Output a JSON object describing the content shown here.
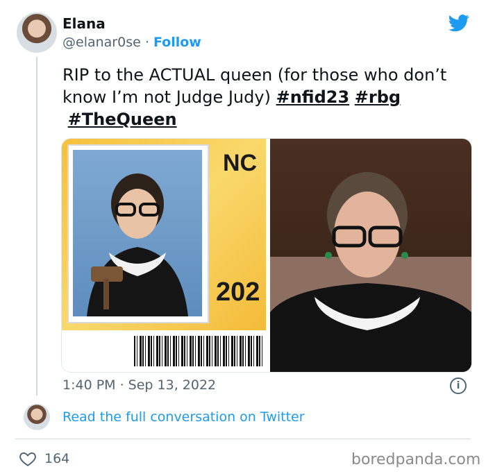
{
  "user": {
    "name": "Elana",
    "handle": "@elanar0se",
    "separator": "·",
    "follow_label": "Follow"
  },
  "tweet": {
    "text_parts": [
      "RIP to the ACTUAL queen (for those who don’t know I’m not Judge Judy) "
    ],
    "hashtags": [
      "#nfid23",
      "#rbg",
      "#TheQueen"
    ],
    "media": {
      "left_card_code": "NC",
      "left_card_year": "202"
    },
    "timestamp": "1:40 PM · Sep 13, 2022"
  },
  "conversation_link": "Read the full conversation on Twitter",
  "likes": {
    "count": "164"
  },
  "watermark": "boredpanda.com",
  "icons": {
    "brand": "twitter-bird-icon",
    "info": "info-icon",
    "like": "heart-icon"
  },
  "colors": {
    "accent": "#1d9bf0",
    "text": "#0f1419",
    "muted": "#536471",
    "divider": "#cfd9de"
  }
}
